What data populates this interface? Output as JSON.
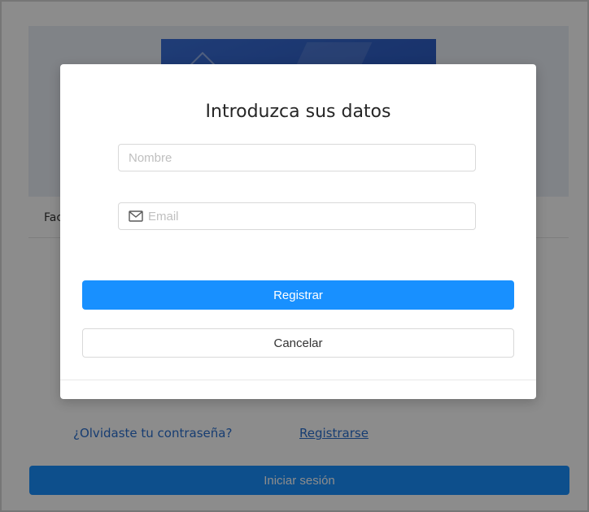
{
  "background": {
    "tab_label": "Fac",
    "forgot_link": "¿Olvidaste tu contraseña?",
    "register_link": "Registrarse",
    "login_button": "Iniciar sesión"
  },
  "modal": {
    "title": "Introduzca sus datos",
    "name_placeholder": "Nombre",
    "email_placeholder": "Email",
    "register_button": "Registrar",
    "cancel_button": "Cancelar",
    "email_icon": "mail-icon"
  },
  "colors": {
    "primary": "#1890ff",
    "link": "#2a6fcf",
    "overlay": "rgba(0,0,0,0.45)"
  }
}
